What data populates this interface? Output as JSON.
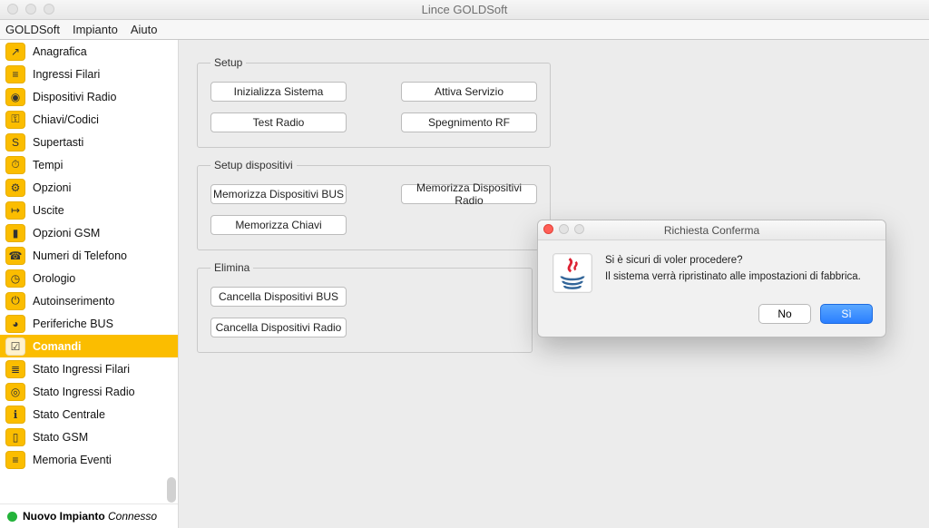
{
  "window": {
    "title": "Lince GOLDSoft"
  },
  "menu": {
    "items": [
      "GOLDSoft",
      "Impianto",
      "Aiuto"
    ]
  },
  "sidebar": {
    "items": [
      {
        "label": "Anagrafica",
        "icon": "route-icon"
      },
      {
        "label": "Ingressi Filari",
        "icon": "wires-icon"
      },
      {
        "label": "Dispositivi Radio",
        "icon": "wifi-icon"
      },
      {
        "label": "Chiavi/Codici",
        "icon": "key-icon"
      },
      {
        "label": "Supertasti",
        "icon": "keys-icon"
      },
      {
        "label": "Tempi",
        "icon": "stopwatch-icon"
      },
      {
        "label": "Opzioni",
        "icon": "gears-icon"
      },
      {
        "label": "Uscite",
        "icon": "output-icon"
      },
      {
        "label": "Opzioni GSM",
        "icon": "bars-icon"
      },
      {
        "label": "Numeri di Telefono",
        "icon": "phonebook-icon"
      },
      {
        "label": "Orologio",
        "icon": "clock-icon"
      },
      {
        "label": "Autoinserimento",
        "icon": "power-icon"
      },
      {
        "label": "Periferiche BUS",
        "icon": "dial-icon"
      },
      {
        "label": "Comandi",
        "icon": "checklist-icon",
        "selected": true
      },
      {
        "label": "Stato Ingressi Filari",
        "icon": "wires-status-icon"
      },
      {
        "label": "Stato Ingressi Radio",
        "icon": "wifi-status-icon"
      },
      {
        "label": "Stato Centrale",
        "icon": "info-icon"
      },
      {
        "label": "Stato GSM",
        "icon": "bars-status-icon"
      },
      {
        "label": "Memoria Eventi",
        "icon": "log-icon"
      }
    ],
    "footer": {
      "name": "Nuovo Impianto",
      "status": "Connesso",
      "dot_color": "#23b33a"
    }
  },
  "content": {
    "groups": [
      {
        "legend": "Setup",
        "rows": [
          [
            {
              "label": "Inizializza Sistema"
            },
            {
              "label": "Attiva Servizio"
            }
          ],
          [
            {
              "label": "Test Radio"
            },
            {
              "label": "Spegnimento RF"
            }
          ]
        ]
      },
      {
        "legend": "Setup dispositivi",
        "rows": [
          [
            {
              "label": "Memorizza Dispositivi BUS"
            },
            {
              "label": "Memorizza Dispositivi Radio"
            }
          ],
          [
            {
              "label": "Memorizza Chiavi"
            }
          ]
        ]
      },
      {
        "legend": "Elimina",
        "rows": [
          [
            {
              "label": "Cancella Dispositivi BUS"
            }
          ],
          [
            {
              "label": "Cancella Dispositivi Radio"
            }
          ]
        ]
      }
    ]
  },
  "dialog": {
    "title": "Richiesta Conferma",
    "line1": "Si è sicuri di voler procedere?",
    "line2": "Il sistema verrà ripristinato alle impostazioni di fabbrica.",
    "no": "No",
    "yes": "Sì"
  },
  "colors": {
    "accent": "#fbbd00",
    "primary_btn": "#2a7eff"
  }
}
